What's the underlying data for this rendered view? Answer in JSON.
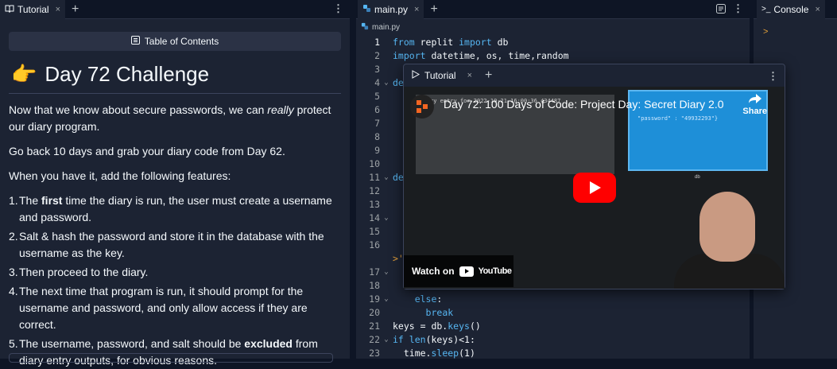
{
  "left": {
    "tab_label": "Tutorial",
    "toc_label": "Table of Contents",
    "title_emoji": "👉",
    "title": "Day 72 Challenge",
    "intro_before": "Now that we know about secure passwords, we can ",
    "intro_em": "really",
    "intro_after": " protect our diary program.",
    "para2": "Go back 10 days and grab your diary code from Day 62.",
    "para3": "When you have it, add the following features:",
    "items": [
      {
        "n": "1.",
        "pre": "The ",
        "bold": "first",
        "post": " time the diary is run, the user must create a username and password."
      },
      {
        "n": "2.",
        "pre": "Salt & hash the password and store it in the database with the username as the key.",
        "bold": "",
        "post": ""
      },
      {
        "n": "3.",
        "pre": "Then proceed to the diary.",
        "bold": "",
        "post": ""
      },
      {
        "n": "4.",
        "pre": "The next time that program is run, it should prompt for the username and password, and only allow access if they are correct.",
        "bold": "",
        "post": ""
      },
      {
        "n": "5.",
        "pre": "The username, password, and salt should be ",
        "bold": "excluded",
        "post": " from diary entry outputs, for obvious reasons."
      }
    ]
  },
  "editor": {
    "tab_label": "main.py",
    "crumb": "main.py"
  },
  "console": {
    "tab_label": "Console",
    "prompt": ">"
  },
  "overlay": {
    "tab_label": "Tutorial",
    "video_title": "Day 72: 100 Days of Code: Project Day: Secret Diary 2.0",
    "share": "Share",
    "watch_on": "Watch on",
    "youtube": "YouTube",
    "slide_left": "ry entry for 2022-10-21 16:00:36.434487",
    "slide_right_1": "\"password\" : \"49932293\"}",
    "db_label": "db"
  },
  "colors": {
    "accent": "#56b6f2",
    "bg": "#1c2333",
    "youtube_red": "#ff0000"
  }
}
